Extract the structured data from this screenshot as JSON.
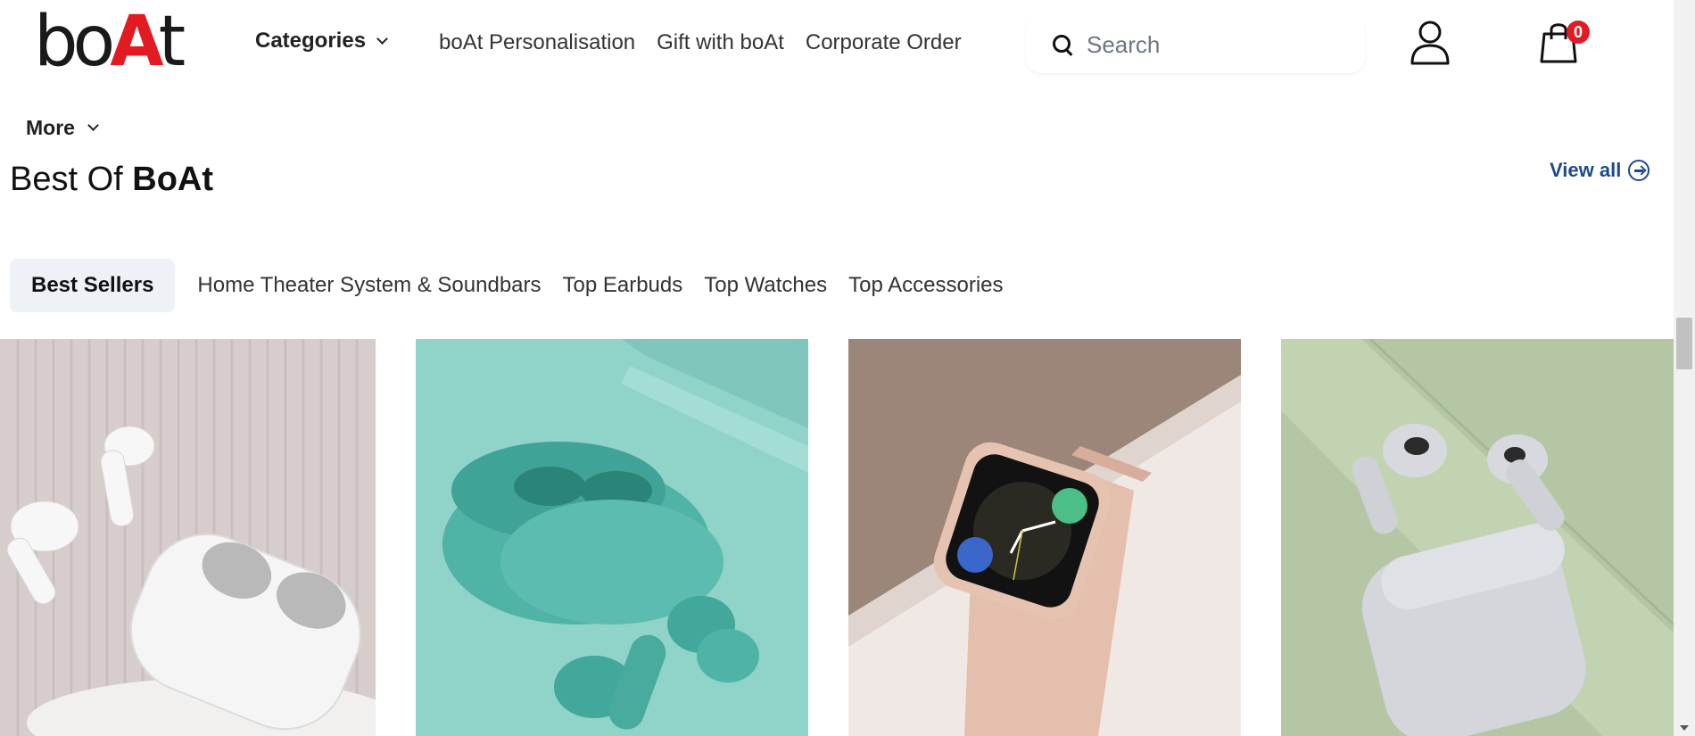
{
  "header": {
    "logo_text_b": "bo",
    "logo_text_a": "A",
    "logo_text_t": "t",
    "categories_label": "Categories",
    "nav": [
      "boAt Personalisation",
      "Gift with boAt",
      "Corporate Order"
    ],
    "search_placeholder": "Search",
    "cart_count": "0",
    "more_label": "More"
  },
  "section": {
    "title_prefix": "Best Of",
    "title_bold": "BoAt",
    "view_all": "View all"
  },
  "tabs": [
    "Best Sellers",
    "Home Theater System & Soundbars",
    "Top Earbuds",
    "Top Watches",
    "Top Accessories"
  ],
  "products": [
    {
      "image": "white-earbuds-photo",
      "bg": "#d6cbcb"
    },
    {
      "image": "teal-earbuds-photo",
      "bg": "#8fd3c9"
    },
    {
      "image": "pink-smartwatch-photo",
      "bg": "#9a8478"
    },
    {
      "image": "grey-earbuds-photo",
      "bg": "#b4c6a4"
    }
  ],
  "colors": {
    "brand_red": "#e21b23",
    "link_blue": "#1e4a8a",
    "tab_active_bg": "#eef1f5"
  }
}
